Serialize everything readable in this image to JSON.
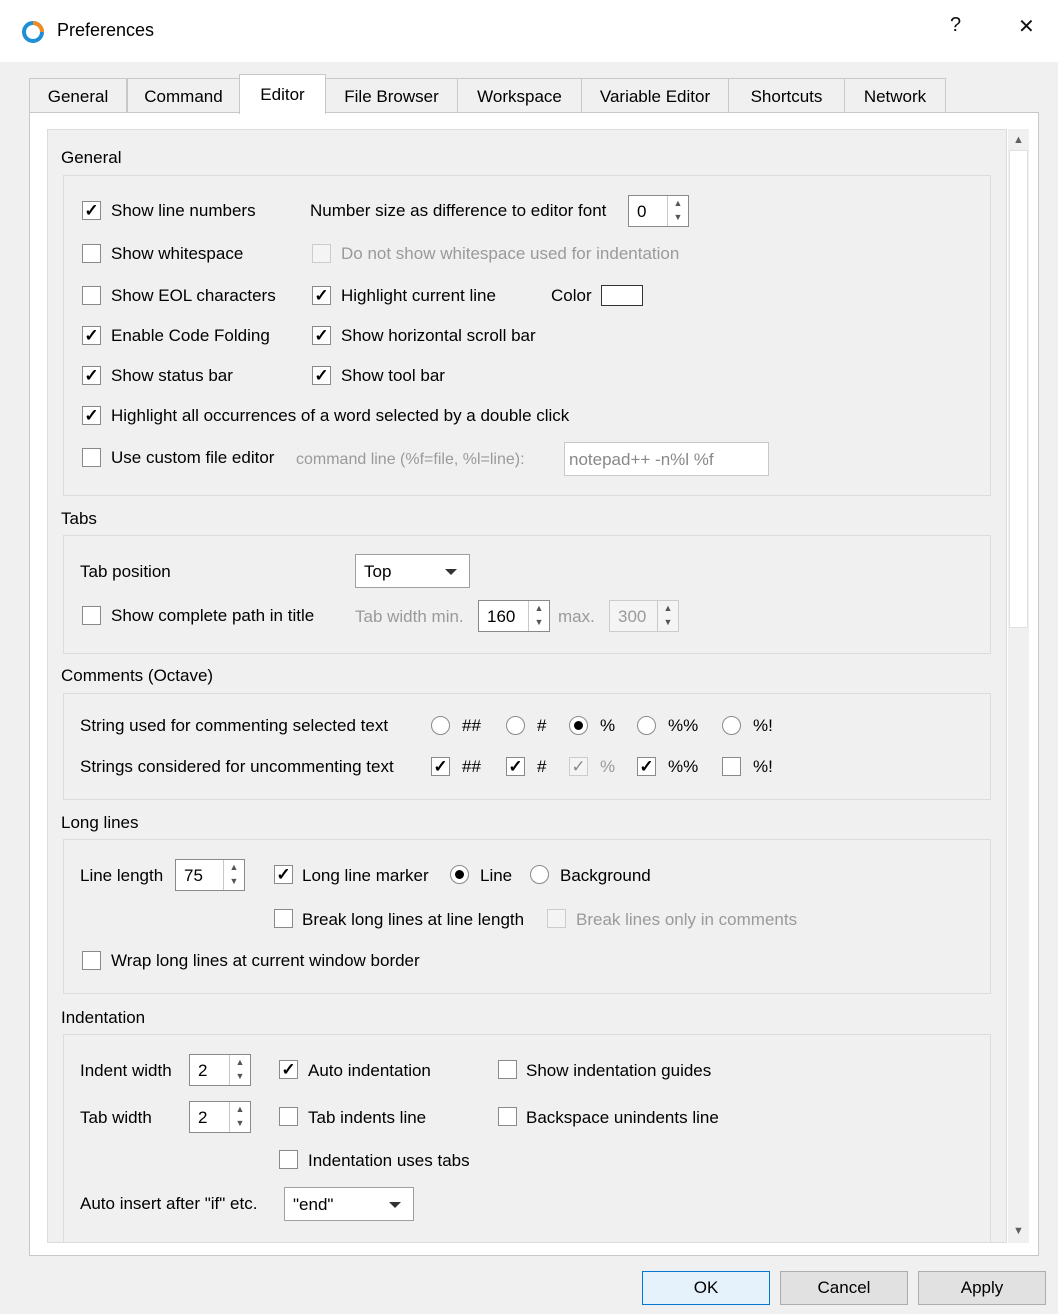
{
  "window": {
    "title": "Preferences",
    "help": "?",
    "close": "✕"
  },
  "tabs": [
    "General",
    "Command",
    "Editor",
    "File Browser",
    "Workspace",
    "Variable Editor",
    "Shortcuts",
    "Network"
  ],
  "general": {
    "heading": "General",
    "show_line_numbers": "Show line numbers",
    "number_size_label": "Number size as difference to editor font",
    "number_size_value": "0",
    "show_whitespace": "Show whitespace",
    "no_ws_indent": "Do not show whitespace used for indentation",
    "show_eol": "Show EOL characters",
    "highlight_line": "Highlight current line",
    "color_label": "Color",
    "code_folding": "Enable Code Folding",
    "hscroll": "Show horizontal scroll bar",
    "status_bar": "Show status bar",
    "tool_bar": "Show tool bar",
    "highlight_occ": "Highlight all occurrences of a word selected by a double click",
    "custom_editor": "Use custom file editor",
    "cmd_line_label": "command line (%f=file, %l=line):",
    "cmd_line_value": "notepad++ -n%l %f"
  },
  "tabsgroup": {
    "heading": "Tabs",
    "tab_position_label": "Tab position",
    "tab_position_value": "Top",
    "complete_path": "Show complete path in title",
    "tab_width_min_label": "Tab width min.",
    "tab_width_min_value": "160",
    "max_label": "max.",
    "max_value": "300"
  },
  "comments": {
    "heading": "Comments (Octave)",
    "commenting_label": "String used for commenting selected text",
    "uncommenting_label": "Strings considered for uncommenting text",
    "options": [
      "##",
      "#",
      "%",
      "%%",
      "%!"
    ]
  },
  "longlines": {
    "heading": "Long lines",
    "line_length_label": "Line length",
    "line_length_value": "75",
    "marker": "Long line marker",
    "line": "Line",
    "background": "Background",
    "break_long": "Break long lines at line length",
    "break_comments": "Break lines only in comments",
    "wrap": "Wrap long lines at current window border"
  },
  "indentation": {
    "heading": "Indentation",
    "indent_width_label": "Indent width",
    "indent_width_value": "2",
    "auto_indent": "Auto indentation",
    "show_guides": "Show indentation guides",
    "tab_width_label": "Tab width",
    "tab_width_value": "2",
    "tab_indents": "Tab indents line",
    "backspace_unindents": "Backspace unindents line",
    "uses_tabs": "Indentation uses tabs",
    "auto_insert_label": "Auto insert after \"if\" etc.",
    "auto_insert_value": "\"end\""
  },
  "buttons": {
    "ok": "OK",
    "cancel": "Cancel",
    "apply": "Apply"
  }
}
